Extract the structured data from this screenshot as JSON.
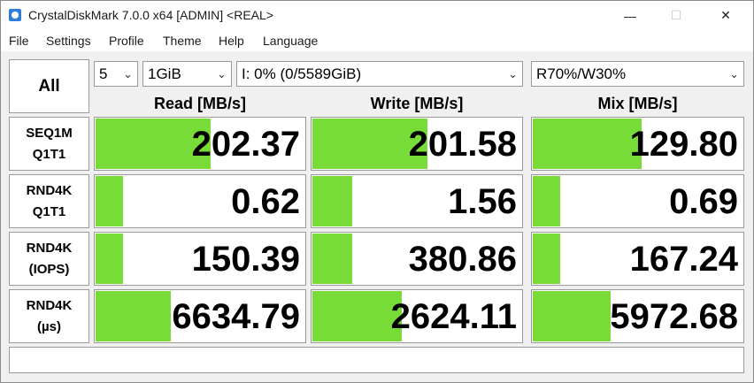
{
  "window": {
    "title": "CrystalDiskMark 7.0.0 x64 [ADMIN] <REAL>",
    "min_glyph": "—",
    "max_glyph": "☐",
    "close_glyph": "✕"
  },
  "menu": [
    "File",
    "Settings",
    "Profile",
    "Theme",
    "Help",
    "Language"
  ],
  "controls": {
    "all_label": "All",
    "count": "5",
    "size": "1GiB",
    "drive": "I: 0% (0/5589GiB)",
    "mix": "R70%/W30%",
    "chevron": "⌄"
  },
  "columns": {
    "read": "Read [MB/s]",
    "write": "Write [MB/s]",
    "mix": "Mix [MB/s]"
  },
  "rows": [
    {
      "line1": "SEQ1M",
      "line2": "Q1T1",
      "read": "202.37",
      "write": "201.58",
      "mix": "129.80",
      "read_fill": 0.55,
      "write_fill": 0.55,
      "mix_fill": 0.52
    },
    {
      "line1": "RND4K",
      "line2": "Q1T1",
      "read": "0.62",
      "write": "1.56",
      "mix": "0.69",
      "read_fill": 0.13,
      "write_fill": 0.19,
      "mix_fill": 0.13
    },
    {
      "line1": "RND4K",
      "line2": "(IOPS)",
      "read": "150.39",
      "write": "380.86",
      "mix": "167.24",
      "read_fill": 0.13,
      "write_fill": 0.19,
      "mix_fill": 0.13
    },
    {
      "line1": "RND4K",
      "line2": "(µs)",
      "read": "6634.79",
      "write": "2624.11",
      "mix": "5972.68",
      "read_fill": 0.36,
      "write_fill": 0.43,
      "mix_fill": 0.37
    }
  ],
  "comment": "",
  "colors": {
    "bar": "#78dc38"
  }
}
